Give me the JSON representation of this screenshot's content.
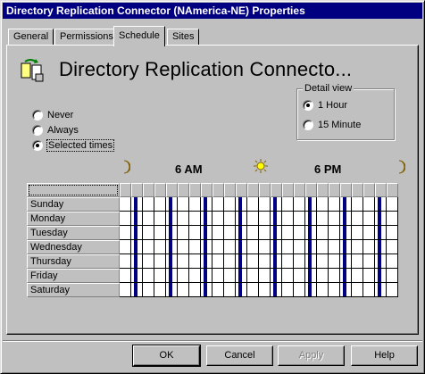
{
  "window": {
    "title": "Directory Replication Connector (NAmerica-NE) Properties",
    "close_label": "×"
  },
  "tabs": [
    {
      "label": "General"
    },
    {
      "label": "Permissions"
    },
    {
      "label": "Schedule",
      "active": true
    },
    {
      "label": "Sites"
    }
  ],
  "header": {
    "title": "Directory Replication Connecto...",
    "icon": "connector-icon"
  },
  "replication": {
    "options": [
      {
        "label": "Never",
        "checked": false
      },
      {
        "label": "Always",
        "checked": false
      },
      {
        "label": "Selected times",
        "checked": true
      }
    ]
  },
  "detail_view": {
    "title": "Detail view",
    "options": [
      {
        "label": "1 Hour",
        "checked": true
      },
      {
        "label": "15 Minute",
        "checked": false
      }
    ]
  },
  "time_axis": {
    "labels": [
      "6 AM",
      "6 PM"
    ],
    "icons": [
      "moon-icon",
      "sun-icon",
      "moon-icon"
    ]
  },
  "schedule": {
    "days": [
      "Sunday",
      "Monday",
      "Tuesday",
      "Wednesday",
      "Thursday",
      "Friday",
      "Saturday"
    ],
    "hours": 24,
    "selected_hours": [
      1,
      4,
      7,
      10,
      13,
      16,
      19,
      22
    ]
  },
  "buttons": {
    "ok": "OK",
    "cancel": "Cancel",
    "apply": "Apply",
    "help": "Help"
  },
  "colors": {
    "title_bar": "#000080",
    "selected_block": "#000080"
  }
}
